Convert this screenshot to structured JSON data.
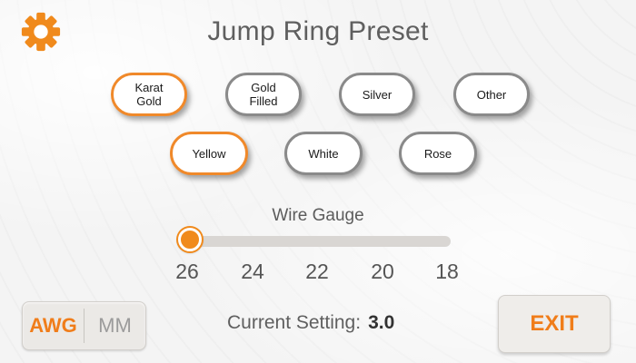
{
  "header": {
    "title": "Jump Ring Preset",
    "settings_icon": "gear-icon",
    "accent_color": "#f08a1c"
  },
  "metal_types": [
    {
      "label": "Karat\nGold",
      "selected": true
    },
    {
      "label": "Gold\nFilled",
      "selected": false
    },
    {
      "label": "Silver",
      "selected": false
    },
    {
      "label": "Other",
      "selected": false
    }
  ],
  "metal_colors": [
    {
      "label": "Yellow",
      "selected": true
    },
    {
      "label": "White",
      "selected": false
    },
    {
      "label": "Rose",
      "selected": false
    }
  ],
  "gauge": {
    "label": "Wire Gauge",
    "ticks": [
      "26",
      "24",
      "22",
      "20",
      "18"
    ],
    "selected_fraction": 0.0
  },
  "units": {
    "awg_label": "AWG",
    "mm_label": "MM",
    "selected": "AWG"
  },
  "status": {
    "label": "Current Setting:",
    "value": "3.0"
  },
  "exit_label": "EXIT"
}
